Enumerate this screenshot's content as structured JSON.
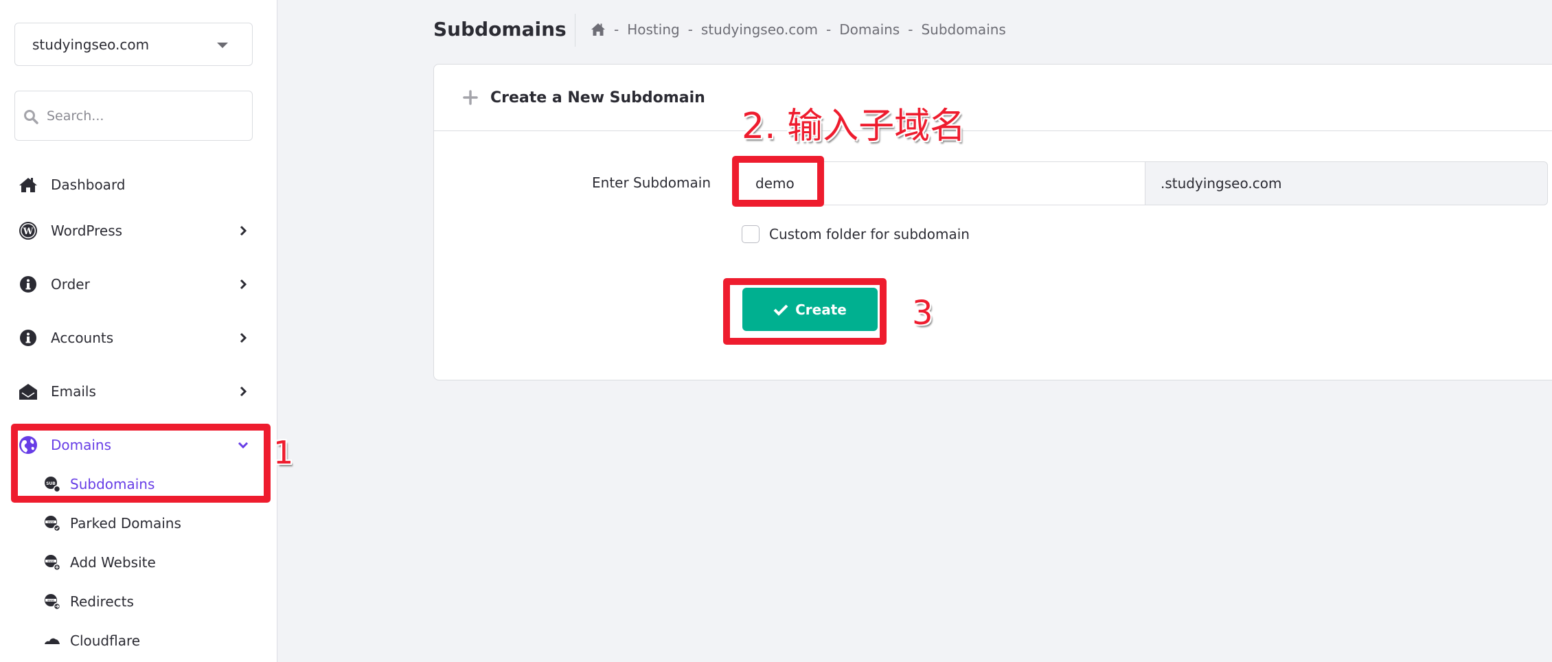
{
  "sidebar": {
    "domain_selector": {
      "value": "studyingseo.com"
    },
    "search": {
      "placeholder": "Search..."
    },
    "items": [
      {
        "label": "Dashboard",
        "icon": "home-icon",
        "has_chevron": false
      },
      {
        "label": "WordPress",
        "icon": "wordpress-icon",
        "has_chevron": true
      },
      {
        "label": "Order",
        "icon": "info-icon",
        "has_chevron": true
      },
      {
        "label": "Accounts",
        "icon": "info-icon",
        "has_chevron": true
      },
      {
        "label": "Emails",
        "icon": "envelope-open-icon",
        "has_chevron": true
      },
      {
        "label": "Domains",
        "icon": "globe-icon",
        "has_chevron": true,
        "expanded": true,
        "active": true
      }
    ],
    "domain_subitems": [
      {
        "label": "Subdomains",
        "icon": "subdomain-icon",
        "active": true
      },
      {
        "label": "Parked Domains",
        "icon": "parked-domain-icon"
      },
      {
        "label": "Add Website",
        "icon": "add-website-icon"
      },
      {
        "label": "Redirects",
        "icon": "redirect-icon"
      },
      {
        "label": "Cloudflare",
        "icon": "cloudflare-icon"
      }
    ]
  },
  "header": {
    "title": "Subdomains",
    "breadcrumb": [
      "Hosting",
      "studyingseo.com",
      "Domains",
      "Subdomains"
    ],
    "breadcrumb_separator": "-"
  },
  "card": {
    "title": "Create a New Subdomain",
    "field_label": "Enter Subdomain",
    "subdomain_value": "demo",
    "suffix": ".studyingseo.com",
    "checkbox_label": "Custom folder for subdomain",
    "checkbox_checked": false,
    "create_label": "Create"
  },
  "annotations": {
    "step1": "1",
    "step2": "2. 输入子域名",
    "step3": "3"
  },
  "colors": {
    "accent": "#673de6",
    "primary_button": "#00b090",
    "annotation": "#ee1c2e",
    "background": "#f2f3f6"
  }
}
